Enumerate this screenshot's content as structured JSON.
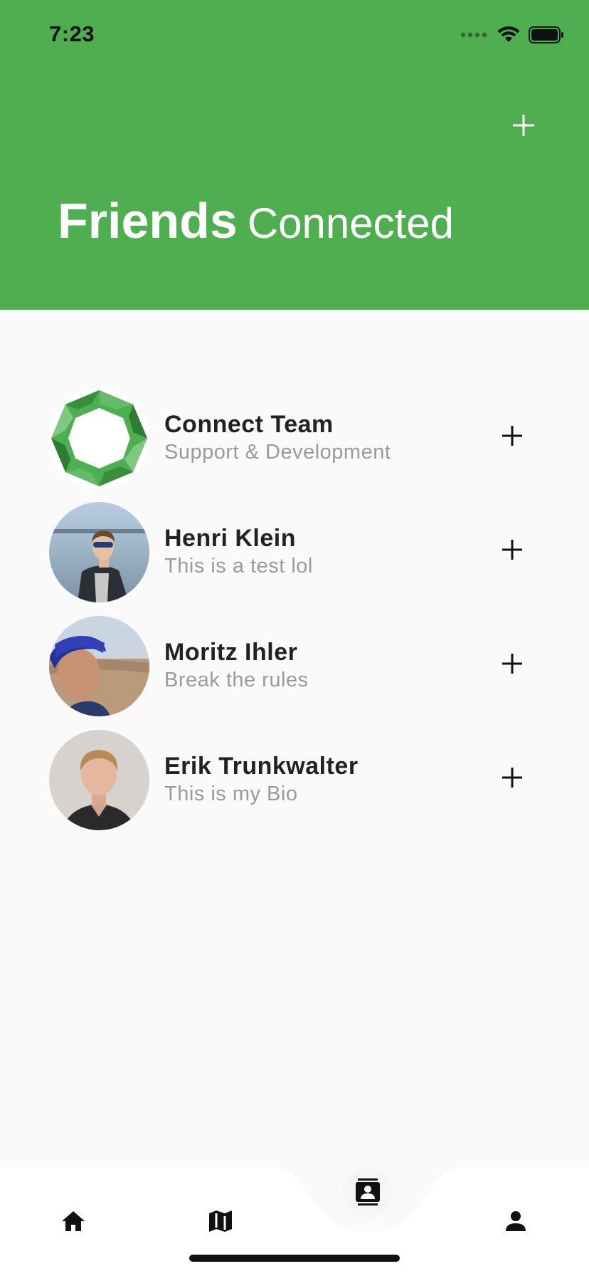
{
  "status_bar": {
    "time": "7:23"
  },
  "header": {
    "title_bold": "Friends",
    "title_light": "Connected",
    "add_icon": "plus-icon",
    "background_color": "#4faf50"
  },
  "friends": [
    {
      "name": "Connect Team",
      "bio": "Support & Development",
      "avatar": "connect-logo"
    },
    {
      "name": "Henri Klein",
      "bio": "This is a test lol",
      "avatar": "photo-henri"
    },
    {
      "name": "Moritz Ihler",
      "bio": "Break the rules",
      "avatar": "photo-moritz"
    },
    {
      "name": "Erik Trunkwalter",
      "bio": "This is my Bio",
      "avatar": "photo-erik"
    }
  ],
  "bottom_nav": {
    "items": [
      {
        "icon": "home-icon",
        "active": false
      },
      {
        "icon": "map-icon",
        "active": false
      },
      {
        "icon": "contacts-icon",
        "active": true
      },
      {
        "icon": "person-icon",
        "active": false
      }
    ]
  }
}
